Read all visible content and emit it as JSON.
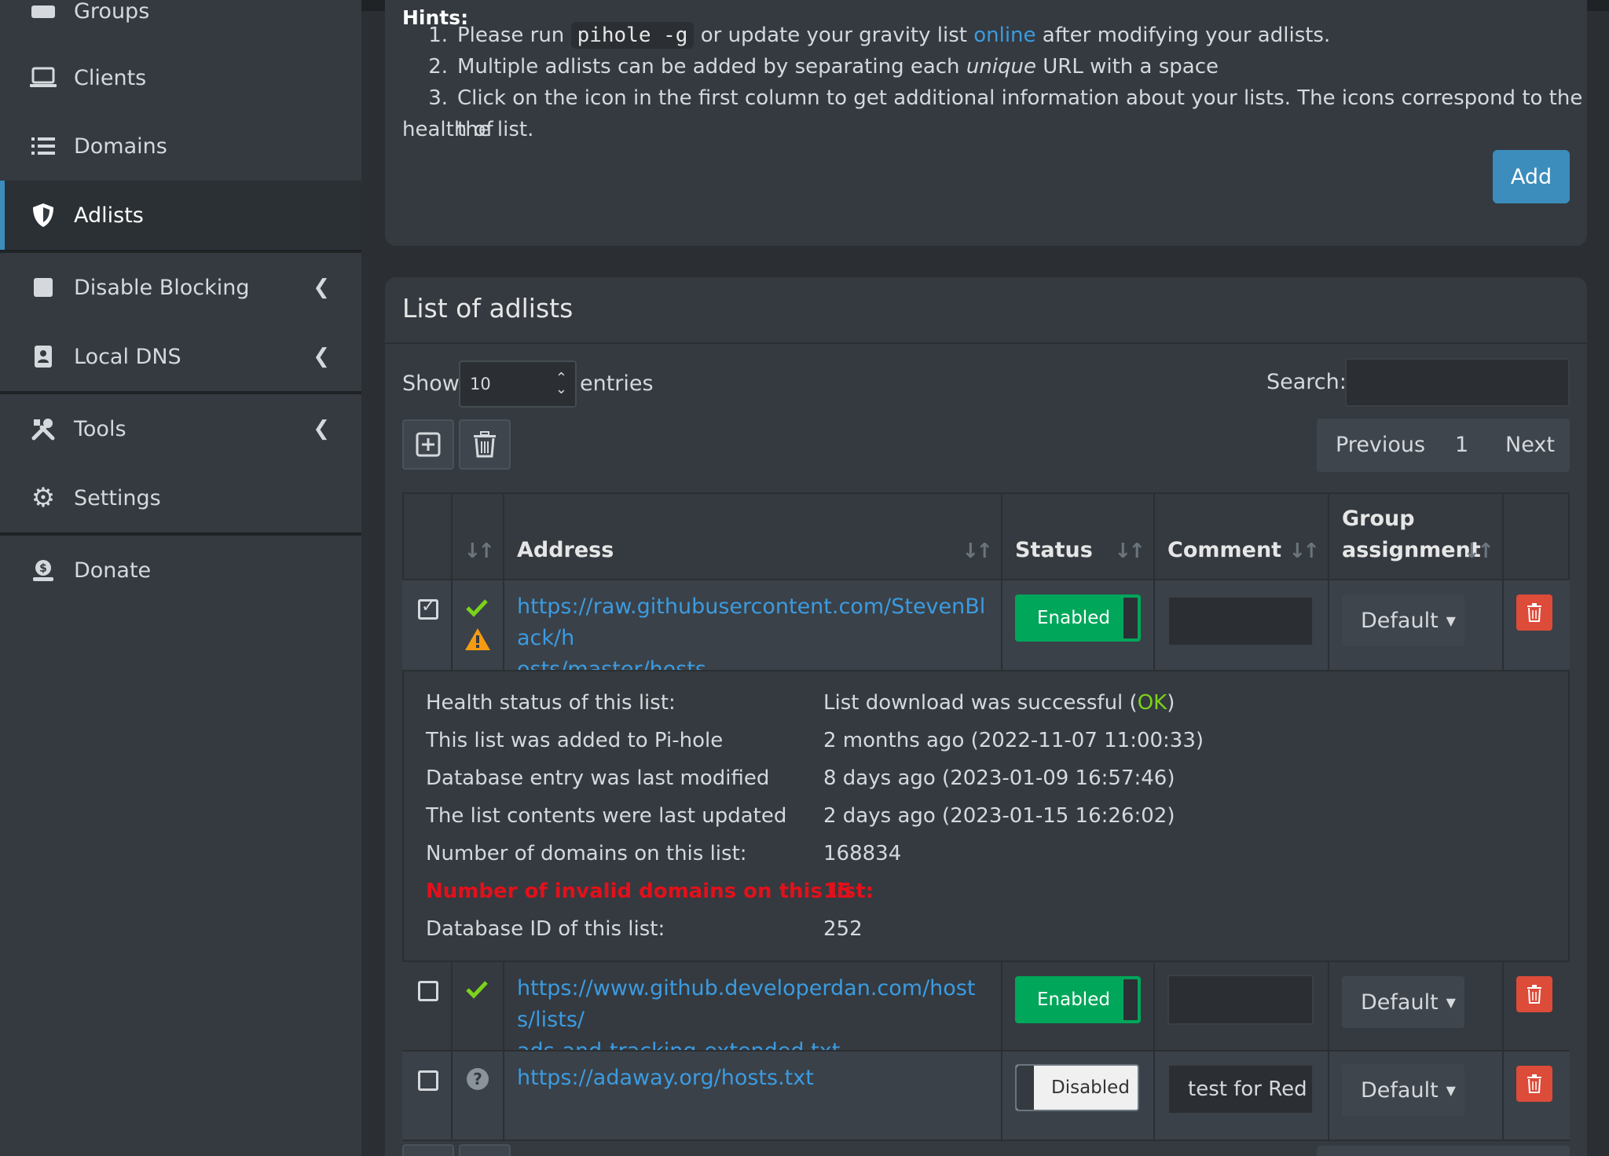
{
  "sidebar": {
    "items": [
      {
        "label": "Groups",
        "icon": "users-icon"
      },
      {
        "label": "Clients",
        "icon": "laptop-icon"
      },
      {
        "label": "Domains",
        "icon": "list-icon"
      },
      {
        "label": "Adlists",
        "icon": "shield-icon",
        "active": true
      },
      {
        "label": "Disable Blocking",
        "icon": "stop-icon"
      },
      {
        "label": "Local DNS",
        "icon": "address-book-icon"
      },
      {
        "label": "Tools",
        "icon": "tools-icon"
      },
      {
        "label": "Settings",
        "icon": "gear-icon"
      },
      {
        "label": "Donate",
        "icon": "donate-icon"
      }
    ]
  },
  "hints": {
    "title": "Hints:",
    "items": [
      {
        "num": "1.",
        "before": "Please run ",
        "code": "pihole -g",
        "middle": " or update your gravity list ",
        "link": "online",
        "after": " after modifying your adlists."
      },
      {
        "num": "2.",
        "before": "Multiple adlists can be added by separating each ",
        "em": "unique",
        "after": " URL with a space"
      },
      {
        "num": "3.",
        "line1": "Click on the icon in the first column to get additional information about your lists. The icons correspond to the health of",
        "line2": "the list."
      }
    ],
    "add_label": "Add"
  },
  "list": {
    "title": "List of adlists",
    "show_label": "Show",
    "entries_value": "10",
    "entries_label": "entries",
    "search_label": "Search:",
    "pager": {
      "previous": "Previous",
      "page": "1",
      "next": "Next"
    },
    "columns": {
      "address": "Address",
      "status": "Status",
      "comment": "Comment",
      "group1": "Group",
      "group2": "assignment"
    },
    "rows": [
      {
        "checked": true,
        "address_line1": "https://raw.githubusercontent.com/StevenBlack/h",
        "address_line2": "osts/master/hosts",
        "status": "Enabled",
        "comment": "",
        "group": "Default",
        "health": [
          "check",
          "warning"
        ]
      },
      {
        "checked": false,
        "address_line1": "https://www.github.developerdan.com/hosts/lists/",
        "address_line2": "ads-and-tracking-extended.txt",
        "status": "Enabled",
        "comment": "",
        "group": "Default",
        "health": [
          "check"
        ]
      },
      {
        "checked": false,
        "address_line1": "https://adaway.org/hosts.txt",
        "address_line2": "",
        "status": "Disabled",
        "comment": "test for Red",
        "group": "Default",
        "health": [
          "question"
        ]
      }
    ],
    "details": {
      "health_k": "Health status of this list:",
      "health_v_prefix": "List download was successful (",
      "health_v_ok": "OK",
      "health_v_suffix": ")",
      "added_k": "This list was added to Pi-hole",
      "added_v": "2 months ago (2022-11-07 11:00:33)",
      "modified_k": "Database entry was last modified",
      "modified_v": "8 days ago (2023-01-09 16:57:46)",
      "updated_k": "The list contents were last updated",
      "updated_v": "2 days ago (2023-01-15 16:26:02)",
      "domains_k": "Number of domains on this list:",
      "domains_v": "168834",
      "invalid_k": "Number of invalid domains on this list:",
      "invalid_v": "15",
      "dbid_k": "Database ID of this list:",
      "dbid_v": "252"
    }
  },
  "colors": {
    "accent": "#3c8dbc",
    "success": "#00a65a",
    "danger": "#dd4b39",
    "warning": "#f39c12",
    "invalid_text": "#e3101a",
    "ok_text": "#7cd21b"
  }
}
